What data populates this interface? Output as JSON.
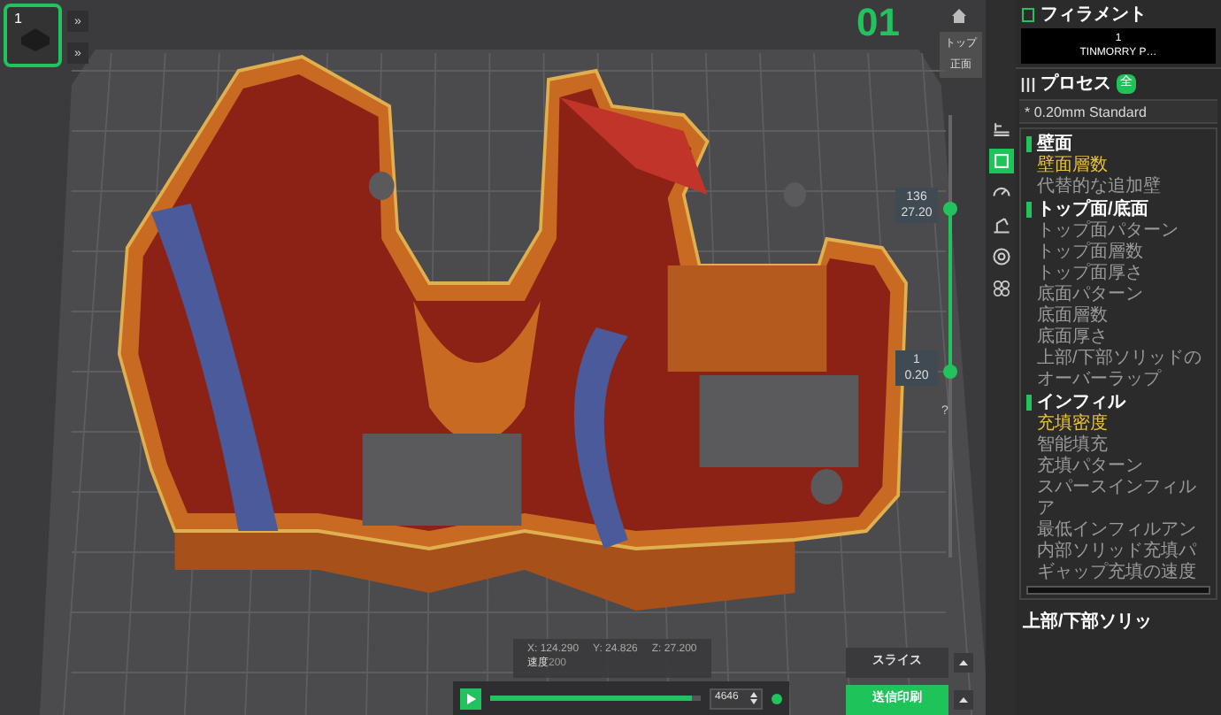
{
  "thumbnail": {
    "label": "1",
    "selected": true
  },
  "thumbnail_buttons": [
    "»",
    "»"
  ],
  "plate_number": "01",
  "view_buttons": [
    "トップ",
    "正面"
  ],
  "layer_slider": {
    "upper_label": [
      "136",
      "27.20"
    ],
    "lower_label": [
      "1",
      "0.20"
    ],
    "upper_handle": {
      "level": 0.79
    },
    "lower_handle": {
      "level": 0.42
    },
    "help": "?"
  },
  "side_tools": [
    {
      "kind": "layers",
      "selected": false
    },
    {
      "kind": "cube",
      "selected": true
    },
    {
      "kind": "gauge",
      "selected": false
    },
    {
      "kind": "support",
      "selected": false
    },
    {
      "kind": "ring",
      "selected": false
    },
    {
      "kind": "pattern",
      "selected": false
    }
  ],
  "position_info": {
    "x": "X: 124.290",
    "y": "Y: 24.826",
    "z": "Z: 27.200",
    "speed_label": "速度",
    "speed_value": "200"
  },
  "playback": {
    "level": 0.96,
    "value": "4646"
  },
  "actions": [
    {
      "label": "スライス",
      "kind": "secondary"
    },
    {
      "label": "送信印刷",
      "kind": "primary"
    }
  ],
  "sidebar": {
    "filament_title": "フィラメント",
    "filament": {
      "index": "1",
      "name": "TINMORRY P…"
    },
    "process_title": "プロセス",
    "process_badge": "全",
    "preset": "* 0.20mm Standard",
    "groups": [
      {
        "title": "壁面",
        "items": [
          {
            "label": "壁面層数",
            "selected": true
          },
          {
            "label": "代替的な追加壁",
            "selected": false
          }
        ]
      },
      {
        "title": "トップ面/底面",
        "items": [
          {
            "label": "トップ面パターン",
            "selected": false
          },
          {
            "label": "トップ面層数",
            "selected": false
          },
          {
            "label": "トップ面厚さ",
            "selected": false
          },
          {
            "label": "底面パターン",
            "selected": false
          },
          {
            "label": "底面層数",
            "selected": false
          },
          {
            "label": "底面厚さ",
            "selected": false
          },
          {
            "label": "上部/下部ソリッドのオーバーラップ",
            "selected": false
          }
        ]
      },
      {
        "title": "インフィル",
        "items": [
          {
            "label": "充填密度",
            "selected": true
          },
          {
            "label": "智能填充",
            "selected": false
          },
          {
            "label": "充填パターン",
            "selected": false
          },
          {
            "label": "スパースインフィルア",
            "selected": false
          },
          {
            "label": "最低インフィルアン",
            "selected": false
          },
          {
            "label": "内部ソリッド充填パ",
            "selected": false
          },
          {
            "label": "ギャップ充填の速度",
            "selected": false
          }
        ]
      }
    ],
    "bottom_title": "上部/下部ソリッ"
  }
}
